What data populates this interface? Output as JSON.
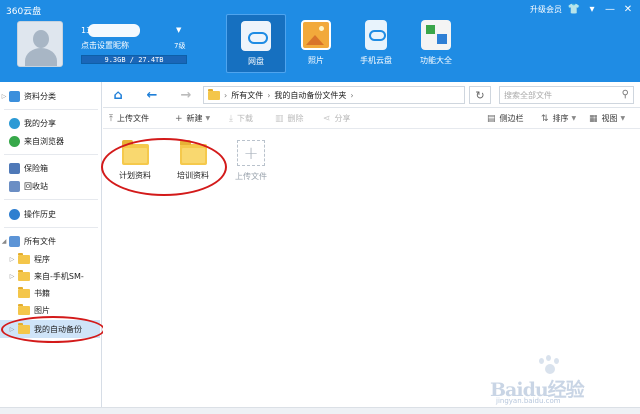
{
  "app": {
    "title": "360云盘"
  },
  "window": {
    "upgrade": "升级会员",
    "controls": [
      "shirt-icon",
      "menu-icon",
      "minimize-icon",
      "close-icon"
    ]
  },
  "user": {
    "id_prefix": "13",
    "nickname": "点击设置昵称",
    "level": "7级",
    "quota_text": "9.3GB / 27.4TB",
    "quota_fraction": 0.0003
  },
  "nav_tabs": [
    {
      "label": "网盘",
      "icon": "cloud-disk-icon",
      "active": true
    },
    {
      "label": "照片",
      "icon": "photo-icon",
      "active": false
    },
    {
      "label": "手机云盘",
      "icon": "phone-cloud-icon",
      "active": false
    },
    {
      "label": "功能大全",
      "icon": "tools-icon",
      "active": false
    }
  ],
  "sidebar": {
    "items": [
      {
        "label": "资料分类",
        "icon": "category-icon"
      },
      {
        "label": "我的分享",
        "icon": "share-icon"
      },
      {
        "label": "来自浏览器",
        "icon": "browser-icon"
      },
      {
        "label": "保险箱",
        "icon": "safe-icon"
      },
      {
        "label": "回收站",
        "icon": "trash-icon"
      },
      {
        "label": "操作历史",
        "icon": "history-icon"
      }
    ],
    "tree_root": "所有文件",
    "tree": [
      {
        "label": "程序",
        "expandable": true
      },
      {
        "label": "来自-手机SM-",
        "expandable": true
      },
      {
        "label": "书籍",
        "expandable": false
      },
      {
        "label": "图片",
        "expandable": false
      },
      {
        "label": "我的自动备份",
        "expandable": true,
        "selected": true
      }
    ]
  },
  "address": {
    "breadcrumb": [
      "所有文件",
      "我的自动备份文件夹"
    ],
    "search_placeholder": "搜索全部文件"
  },
  "toolbar": {
    "upload": "上传文件",
    "new": "新建",
    "download": "下载",
    "delete": "删除",
    "share": "分享",
    "sidebar": "侧边栏",
    "sort": "排序",
    "view": "视图"
  },
  "files": [
    {
      "name": "计划资料",
      "type": "folder"
    },
    {
      "name": "培训资料",
      "type": "folder"
    }
  ],
  "upload_tile": {
    "label": "上传文件"
  },
  "watermark": {
    "brand": "Baidu经验",
    "url": "jingyan.baidu.com"
  },
  "colors": {
    "header": "#1f8ce4",
    "annotation": "#d31a1a",
    "selected": "#cfe4f8"
  }
}
